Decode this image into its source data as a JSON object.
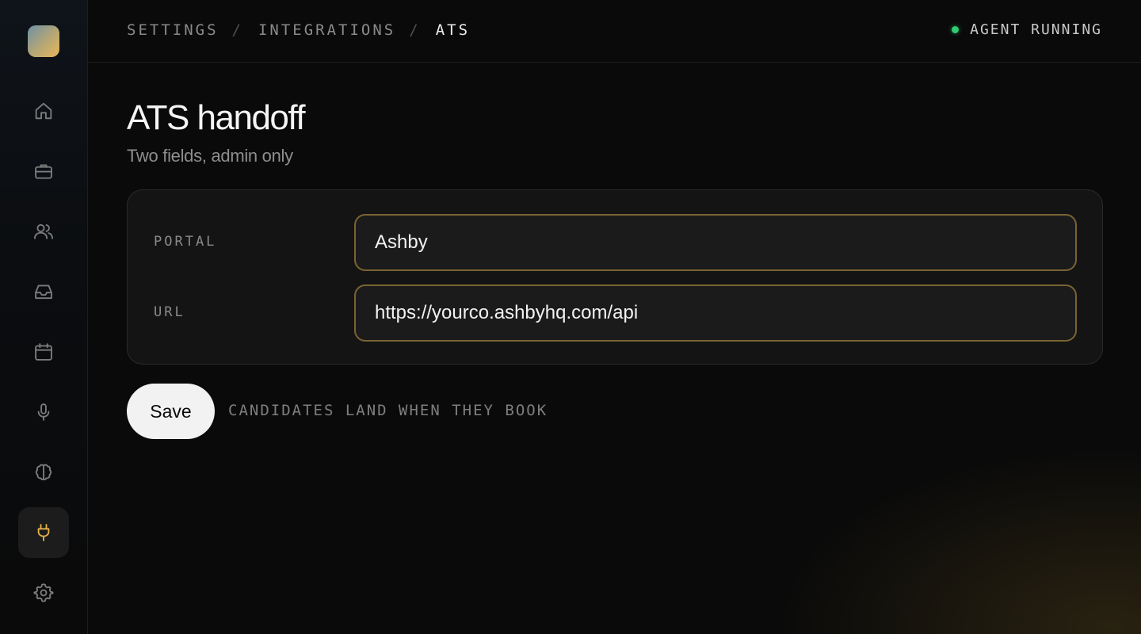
{
  "sidebar": {
    "items": [
      {
        "name": "home-icon"
      },
      {
        "name": "briefcase-icon"
      },
      {
        "name": "users-icon"
      },
      {
        "name": "inbox-icon"
      },
      {
        "name": "calendar-icon"
      },
      {
        "name": "microphone-icon"
      },
      {
        "name": "brain-icon"
      },
      {
        "name": "plug-icon",
        "active": true
      },
      {
        "name": "gear-icon"
      }
    ]
  },
  "breadcrumb": {
    "items": [
      "SETTINGS",
      "INTEGRATIONS",
      "ATS"
    ],
    "separator": "/"
  },
  "status": {
    "label": "AGENT RUNNING",
    "color": "#2ecc71"
  },
  "page": {
    "title": "ATS handoff",
    "subtitle": "Two fields, admin only"
  },
  "form": {
    "portal_label": "PORTAL",
    "portal_value": "Ashby",
    "url_label": "URL",
    "url_value": "https://yourco.ashbyhq.com/api"
  },
  "actions": {
    "save_label": "Save",
    "note": "CANDIDATES LAND WHEN THEY BOOK"
  },
  "colors": {
    "accent": "#e3b04b",
    "input_border": "#7a6333",
    "background": "#0a0a0a"
  }
}
